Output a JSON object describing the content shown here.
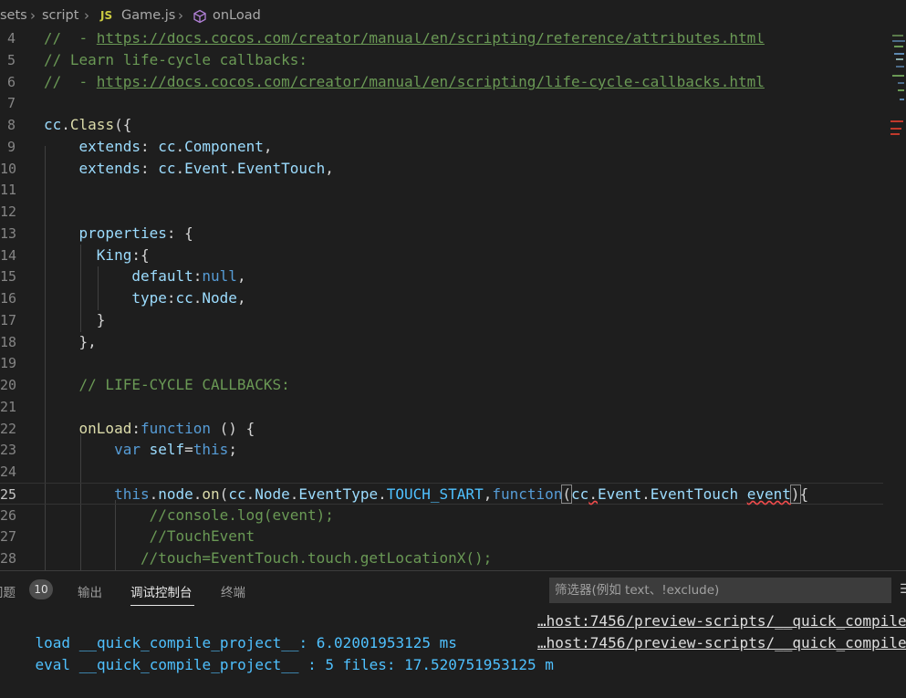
{
  "breadcrumb": {
    "items": [
      "sets",
      "script",
      "Game.js",
      "onLoad"
    ],
    "js_badge": "JS"
  },
  "editor": {
    "current_line": "25",
    "lines": [
      {
        "n": "4",
        "segs": [
          {
            "t": "//  - ",
            "c": "c"
          },
          {
            "t": "https://docs.cocos.com/creator/manual/en/scripting/reference/attributes.html",
            "c": "lk"
          }
        ]
      },
      {
        "n": "5",
        "segs": [
          {
            "t": "// Learn life-cycle callbacks:",
            "c": "c"
          }
        ]
      },
      {
        "n": "6",
        "segs": [
          {
            "t": "//  - ",
            "c": "c"
          },
          {
            "t": "https://docs.cocos.com/creator/manual/en/scripting/life-cycle-callbacks.html",
            "c": "lk"
          }
        ]
      },
      {
        "n": "7",
        "segs": []
      },
      {
        "n": "8",
        "segs": [
          {
            "t": "cc",
            "c": "v"
          },
          {
            "t": ".",
            "c": "p"
          },
          {
            "t": "Class",
            "c": "f"
          },
          {
            "t": "({",
            "c": "p"
          }
        ]
      },
      {
        "n": "9",
        "segs": [
          {
            "t": "    extends",
            "c": "v"
          },
          {
            "t": ": ",
            "c": "p"
          },
          {
            "t": "cc",
            "c": "v"
          },
          {
            "t": ".",
            "c": "p"
          },
          {
            "t": "Component",
            "c": "v"
          },
          {
            "t": ",",
            "c": "p"
          }
        ]
      },
      {
        "n": "10",
        "segs": [
          {
            "t": "    extends",
            "c": "v"
          },
          {
            "t": ": ",
            "c": "p"
          },
          {
            "t": "cc",
            "c": "v"
          },
          {
            "t": ".",
            "c": "p"
          },
          {
            "t": "Event",
            "c": "v"
          },
          {
            "t": ".",
            "c": "p"
          },
          {
            "t": "EventTouch",
            "c": "v"
          },
          {
            "t": ",",
            "c": "p"
          }
        ]
      },
      {
        "n": "11",
        "segs": []
      },
      {
        "n": "12",
        "segs": []
      },
      {
        "n": "13",
        "segs": [
          {
            "t": "    properties",
            "c": "v"
          },
          {
            "t": ": {",
            "c": "p"
          }
        ]
      },
      {
        "n": "14",
        "segs": [
          {
            "t": "      King",
            "c": "v"
          },
          {
            "t": ":{",
            "c": "p"
          }
        ]
      },
      {
        "n": "15",
        "segs": [
          {
            "t": "          default",
            "c": "v"
          },
          {
            "t": ":",
            "c": "p"
          },
          {
            "t": "null",
            "c": "k"
          },
          {
            "t": ",",
            "c": "p"
          }
        ]
      },
      {
        "n": "16",
        "segs": [
          {
            "t": "          type",
            "c": "v"
          },
          {
            "t": ":",
            "c": "p"
          },
          {
            "t": "cc",
            "c": "v"
          },
          {
            "t": ".",
            "c": "p"
          },
          {
            "t": "Node",
            "c": "v"
          },
          {
            "t": ",",
            "c": "p"
          }
        ]
      },
      {
        "n": "17",
        "segs": [
          {
            "t": "      }",
            "c": "p"
          }
        ]
      },
      {
        "n": "18",
        "segs": [
          {
            "t": "    },",
            "c": "p"
          }
        ]
      },
      {
        "n": "19",
        "segs": []
      },
      {
        "n": "20",
        "segs": [
          {
            "t": "    // LIFE-CYCLE CALLBACKS:",
            "c": "c"
          }
        ]
      },
      {
        "n": "21",
        "segs": []
      },
      {
        "n": "22",
        "segs": [
          {
            "t": "    onLoad",
            "c": "f"
          },
          {
            "t": ":",
            "c": "p"
          },
          {
            "t": "function",
            "c": "k"
          },
          {
            "t": " () {",
            "c": "p"
          }
        ]
      },
      {
        "n": "23",
        "segs": [
          {
            "t": "        ",
            "c": "p"
          },
          {
            "t": "var",
            "c": "k"
          },
          {
            "t": " ",
            "c": "p"
          },
          {
            "t": "self",
            "c": "v"
          },
          {
            "t": "=",
            "c": "p"
          },
          {
            "t": "this",
            "c": "k"
          },
          {
            "t": ";",
            "c": "p"
          }
        ]
      },
      {
        "n": "24",
        "segs": []
      },
      {
        "n": "25",
        "segs": [
          {
            "t": "        ",
            "c": "p"
          },
          {
            "t": "this",
            "c": "k"
          },
          {
            "t": ".",
            "c": "p"
          },
          {
            "t": "node",
            "c": "v"
          },
          {
            "t": ".",
            "c": "p"
          },
          {
            "t": "on",
            "c": "f"
          },
          {
            "t": "(",
            "c": "p"
          },
          {
            "t": "cc",
            "c": "v"
          },
          {
            "t": ".",
            "c": "p"
          },
          {
            "t": "Node",
            "c": "v"
          },
          {
            "t": ".",
            "c": "p"
          },
          {
            "t": "EventType",
            "c": "v"
          },
          {
            "t": ".",
            "c": "p"
          },
          {
            "t": "TOUCH_START",
            "c": "cn"
          },
          {
            "t": ",",
            "c": "p"
          },
          {
            "t": "function",
            "c": "k"
          },
          {
            "t": "(",
            "c": "p bracket"
          },
          {
            "t": "cc",
            "c": "v"
          },
          {
            "t": ".",
            "c": "p sq"
          },
          {
            "t": "Event",
            "c": "v"
          },
          {
            "t": ".",
            "c": "p"
          },
          {
            "t": "EventTouch",
            "c": "v"
          },
          {
            "t": " ",
            "c": "p"
          },
          {
            "t": "event",
            "c": "v sq"
          },
          {
            "t": ")",
            "c": "p bracket"
          },
          {
            "t": "{",
            "c": "p"
          }
        ]
      },
      {
        "n": "26",
        "segs": [
          {
            "t": "            //console.log(event);",
            "c": "c"
          }
        ]
      },
      {
        "n": "27",
        "segs": [
          {
            "t": "            //TouchEvent",
            "c": "c"
          }
        ]
      },
      {
        "n": "28",
        "segs": [
          {
            "t": "           //touch=EventTouch.touch.getLocationX();",
            "c": "c"
          }
        ]
      }
    ]
  },
  "panel": {
    "tabs": [
      {
        "label": "问题",
        "active": false
      },
      {
        "label": "输出",
        "active": false
      },
      {
        "label": "调试控制台",
        "active": true
      },
      {
        "label": "终端",
        "active": false
      }
    ],
    "problems_count": "10",
    "filter_placeholder": "筛选器(例如 text、!exclude)",
    "console": [
      {
        "msg": "load __quick_compile_project__: 6.02001953125 ms",
        "src": "…host:7456/preview-scripts/__quick_compile"
      },
      {
        "msg": "eval __quick_compile_project__ : 5 files: 17.520751953125 m",
        "src": "…host:7456/preview-scripts/__quick_compile"
      }
    ]
  },
  "colors": {
    "background": "#1e1e1e",
    "comment": "#6a9955",
    "keyword": "#569cd6",
    "variable": "#9cdcfe",
    "function": "#dcdcaa",
    "constant": "#4fc1ff"
  }
}
